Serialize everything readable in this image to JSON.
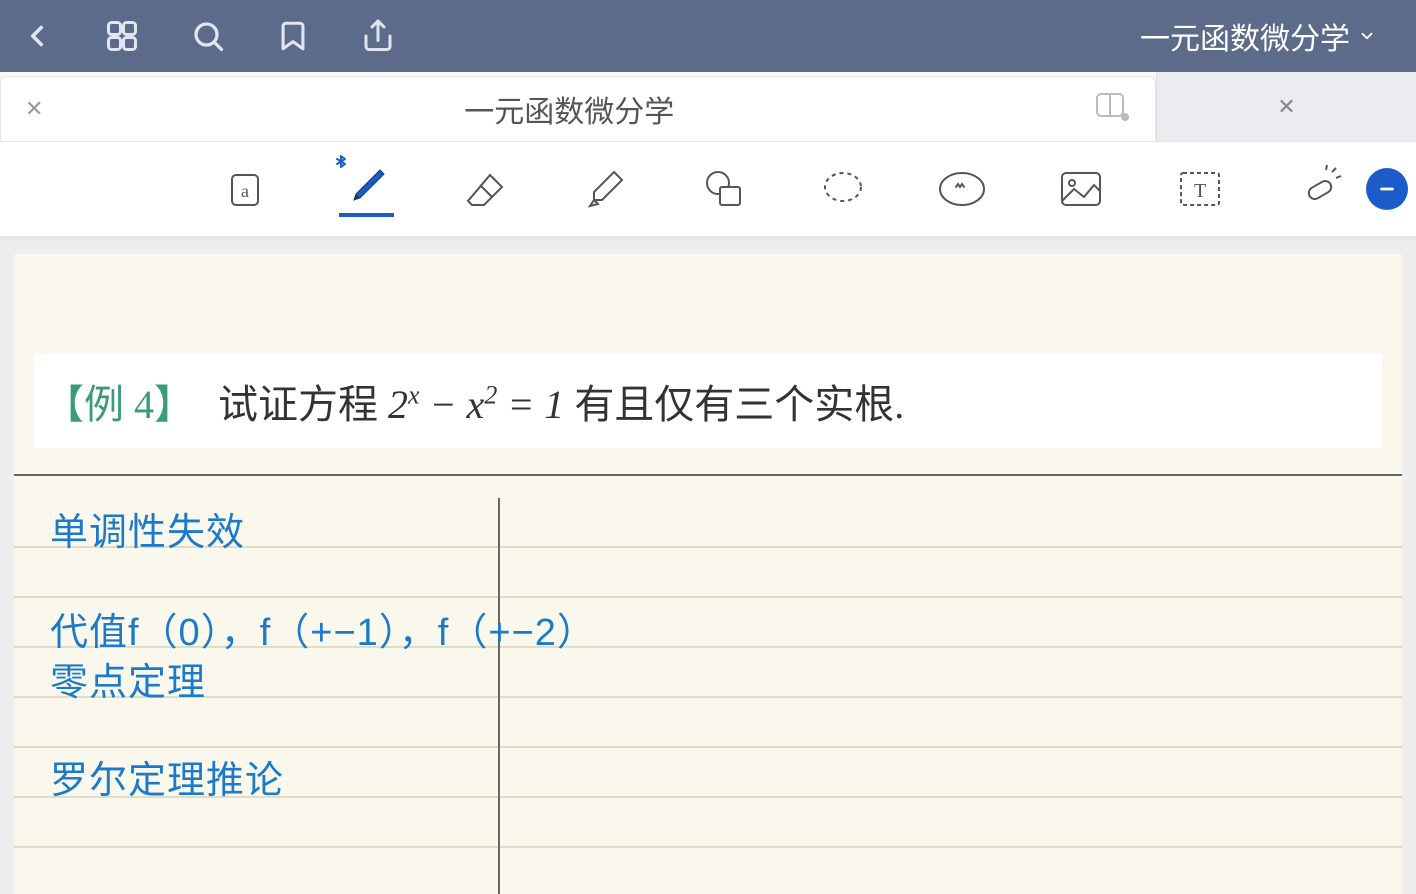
{
  "header": {
    "dropdown_title": "一元函数微分学"
  },
  "tab": {
    "title": "一元函数微分学"
  },
  "problem": {
    "tag": "【例 4】",
    "text_before": "试证方程 ",
    "equation_html": "2<sup>x</sup> − x<sup>2</sup> = 1",
    "text_after": " 有且仅有三个实根."
  },
  "notes": {
    "line1": "单调性失效",
    "line2": "代值f（0），f（+−1），f（+−2）",
    "line3": "零点定理",
    "line4": "罗尔定理推论"
  }
}
